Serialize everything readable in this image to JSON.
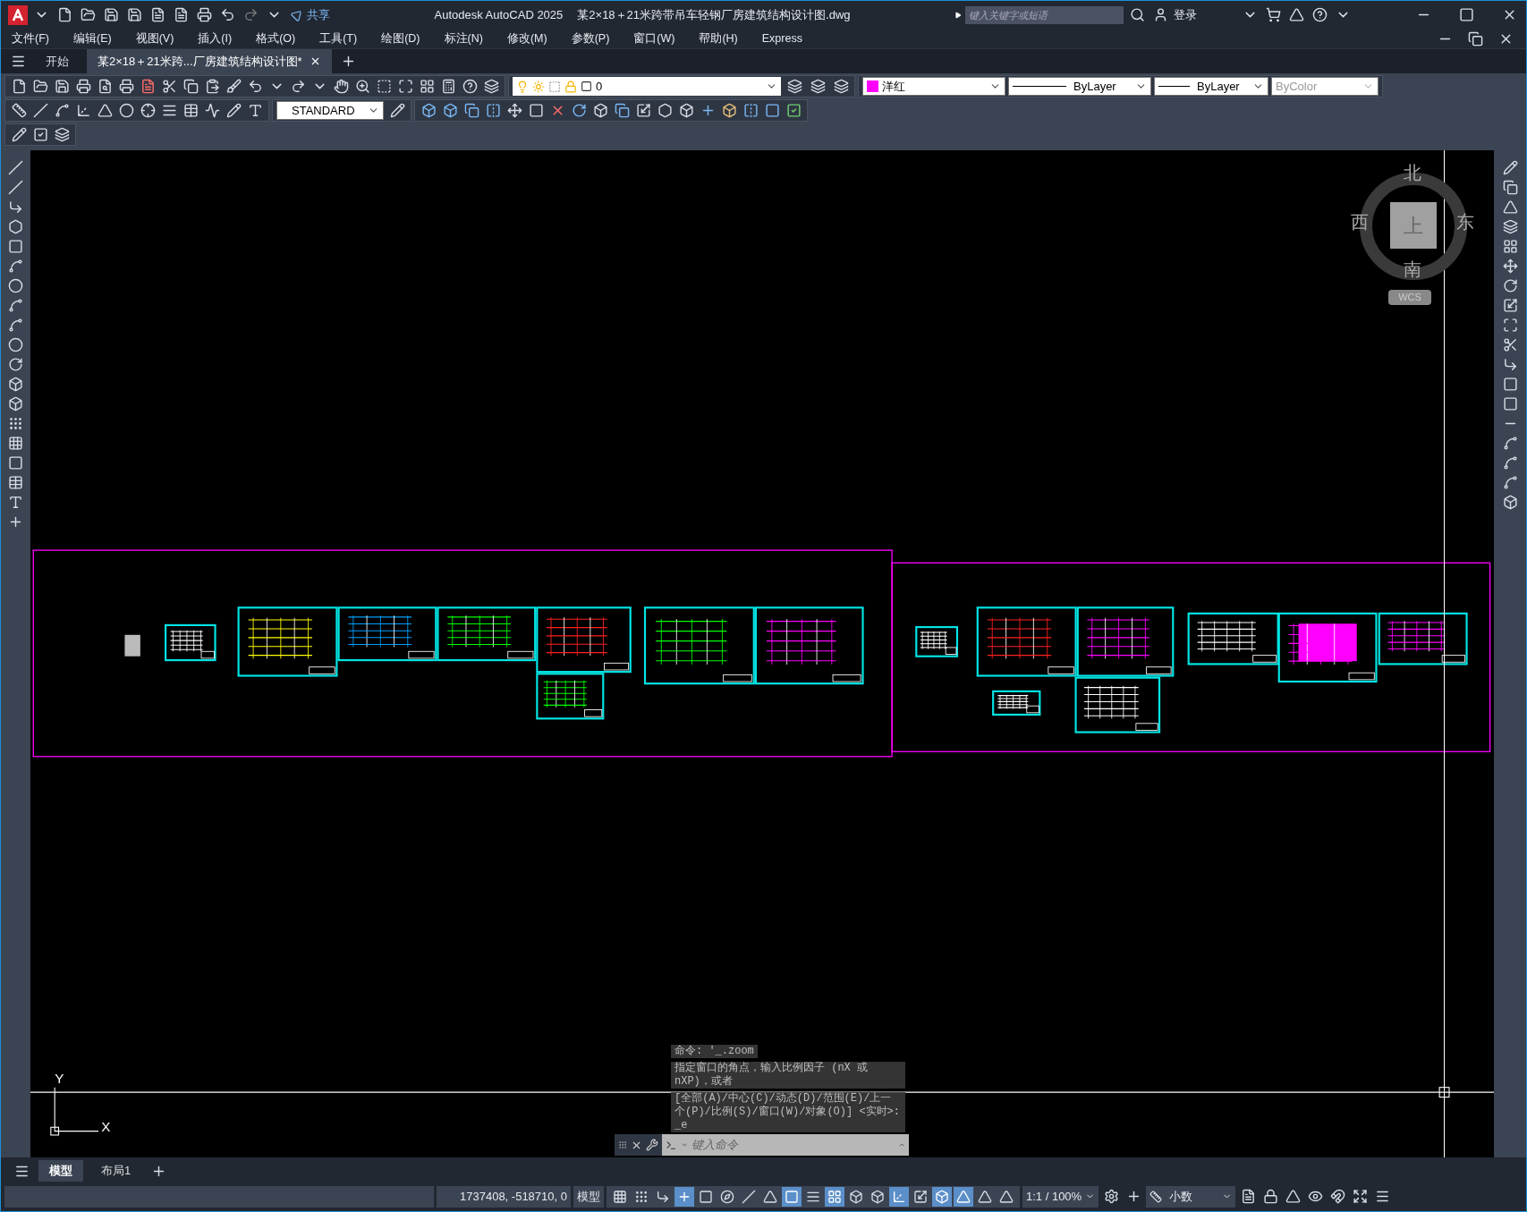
{
  "title_bar": {
    "share": "共享",
    "title": "Autodesk AutoCAD 2025",
    "file": "某2×18＋21米跨带吊车轻钢厂房建筑结构设计图.dwg",
    "search_placeholder": "键入关键字或短语",
    "login": "登录"
  },
  "menu": [
    "文件(F)",
    "编辑(E)",
    "视图(V)",
    "插入(I)",
    "格式(O)",
    "工具(T)",
    "绘图(D)",
    "标注(N)",
    "修改(M)",
    "参数(P)",
    "窗口(W)",
    "帮助(H)",
    "Express"
  ],
  "doc_tabs": [
    {
      "label": "开始",
      "selected": false
    },
    {
      "label": "某2×18＋21米跨...厂房建筑结构设计图*",
      "selected": true,
      "closable": true
    }
  ],
  "layer": {
    "name": "0"
  },
  "text_style": "STANDARD",
  "properties": {
    "color": {
      "label": "洋红",
      "color": "#ff00ff"
    },
    "linetype": "ByLayer",
    "lineweight": "ByLayer",
    "plot_style": {
      "label": "ByColor",
      "disabled": true
    }
  },
  "viewcube": {
    "north": "北",
    "south": "南",
    "east": "东",
    "west": "西",
    "face": "上",
    "ucs": "WCS"
  },
  "ucs_axes": {
    "x": "X",
    "y": "Y"
  },
  "command_history": [
    "命令: '_.zoom",
    "指定窗口的角点，输入比例因子 (nX 或 nXP)，或者",
    "[全部(A)/中心(C)/动态(D)/范围(E)/上一个(P)/比例(S)/窗口(W)/对象(O)] <实时>: _e"
  ],
  "command_placeholder": "键入命令",
  "layout_tabs": [
    {
      "label": "模型",
      "selected": true
    },
    {
      "label": "布局1",
      "selected": false
    }
  ],
  "status_bar": {
    "coordinates": "1737408, -518710, 0",
    "space": "模型",
    "scale": "1:1 / 100%",
    "units": "小数",
    "toggles": [
      {
        "on": false
      },
      {
        "on": false
      },
      {
        "on": false
      },
      {
        "on": true
      },
      {
        "on": false
      },
      {
        "on": false
      },
      {
        "on": false
      },
      {
        "on": false
      },
      {
        "on": true
      },
      {
        "on": false
      },
      {
        "on": true
      },
      {
        "on": false
      },
      {
        "on": false
      },
      {
        "on": true
      },
      {
        "on": false
      },
      {
        "on": true
      },
      {
        "on": true
      },
      {
        "on": false
      },
      {
        "on": false
      }
    ]
  }
}
